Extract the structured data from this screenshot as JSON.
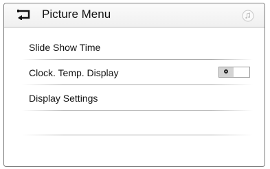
{
  "header": {
    "title": "Picture Menu",
    "back_icon": "back-arrow-icon",
    "media_icon": "music-note-icon"
  },
  "menu": {
    "items": [
      {
        "label": "Slide Show Time"
      },
      {
        "label": "Clock. Temp. Display",
        "toggle": {
          "state": "off",
          "icon": "radio-dot-icon"
        }
      },
      {
        "label": "Display Settings"
      }
    ]
  },
  "colors": {
    "frame": "#7a7a7a",
    "header_bg": "#f0f0f0",
    "separator": "#a9a9a9",
    "toggle_knob": "#d4d4d4"
  }
}
